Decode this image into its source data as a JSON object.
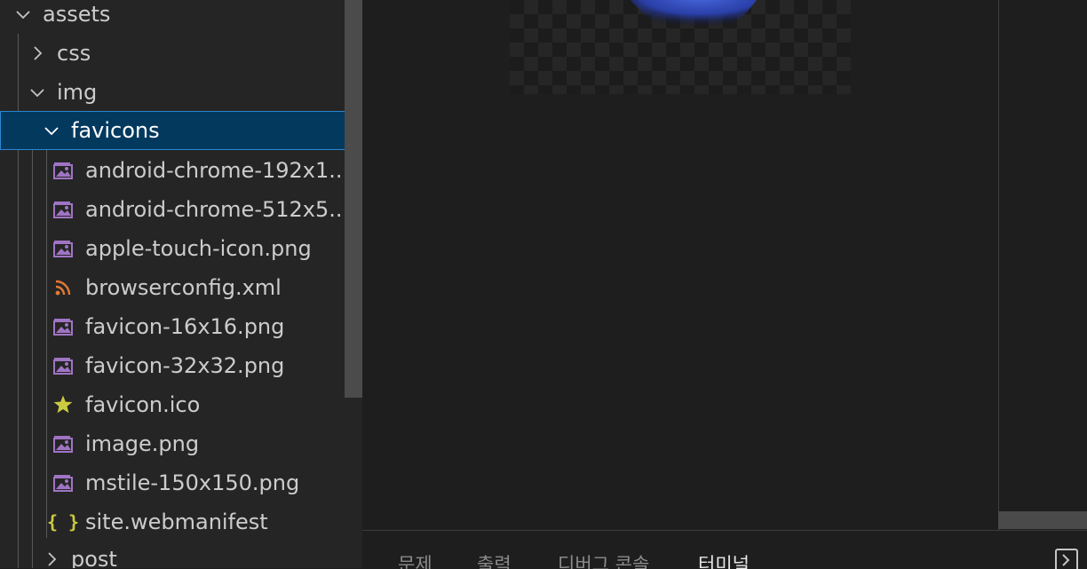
{
  "explorer": {
    "items": [
      {
        "label": "assets",
        "type": "folder",
        "expanded": true
      },
      {
        "label": "css",
        "type": "folder",
        "expanded": false
      },
      {
        "label": "img",
        "type": "folder",
        "expanded": true
      },
      {
        "label": "favicons",
        "type": "folder",
        "expanded": true,
        "selected": true
      },
      {
        "label": "android-chrome-192x1...",
        "type": "file",
        "icon": "image-file-icon"
      },
      {
        "label": "android-chrome-512x5...",
        "type": "file",
        "icon": "image-file-icon"
      },
      {
        "label": "apple-touch-icon.png",
        "type": "file",
        "icon": "image-file-icon"
      },
      {
        "label": "browserconfig.xml",
        "type": "file",
        "icon": "rss-xml-icon"
      },
      {
        "label": "favicon-16x16.png",
        "type": "file",
        "icon": "image-file-icon"
      },
      {
        "label": "favicon-32x32.png",
        "type": "file",
        "icon": "image-file-icon"
      },
      {
        "label": "favicon.ico",
        "type": "file",
        "icon": "star-icon"
      },
      {
        "label": "image.png",
        "type": "file",
        "icon": "image-file-icon"
      },
      {
        "label": "mstile-150x150.png",
        "type": "file",
        "icon": "image-file-icon"
      },
      {
        "label": "site.webmanifest",
        "type": "file",
        "icon": "json-braces-icon"
      },
      {
        "label": "post",
        "type": "folder",
        "expanded": false
      }
    ]
  },
  "panel": {
    "tabs": [
      {
        "label": "문제",
        "active": false
      },
      {
        "label": "출력",
        "active": false
      },
      {
        "label": "디버그 콘솔",
        "active": false
      },
      {
        "label": "터미널",
        "active": true
      }
    ]
  },
  "icons": {
    "braces_glyph": "{ }"
  },
  "colors": {
    "sidebar_bg": "#252526",
    "editor_bg": "#1e1e1e",
    "selection_bg": "#04395e",
    "selection_border": "#2a87d0",
    "image_icon": "#a074c4",
    "rss_icon": "#e37933",
    "star_icon": "#cbcb41",
    "braces_icon": "#cbcb41"
  }
}
